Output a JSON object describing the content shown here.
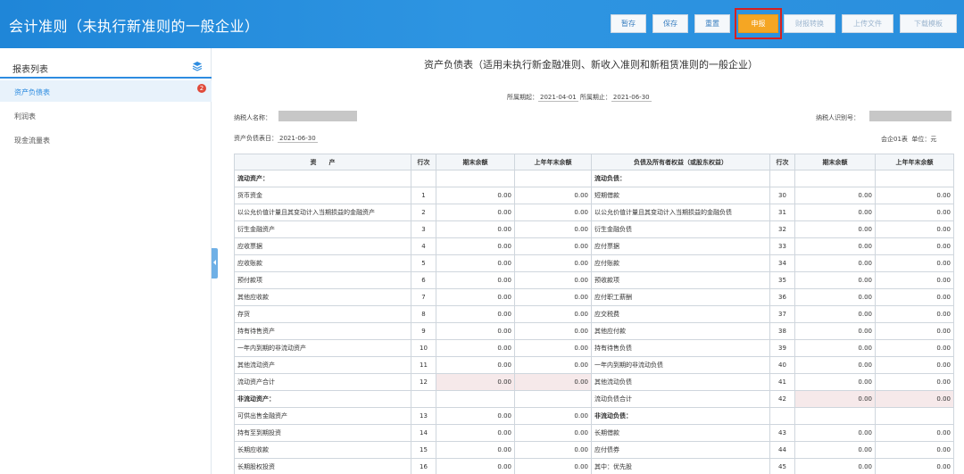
{
  "header": {
    "title": "会计准则（未执行新准则的一般企业）",
    "buttons": [
      {
        "label": "暂存",
        "state": "normal"
      },
      {
        "label": "保存",
        "state": "normal"
      },
      {
        "label": "重置",
        "state": "normal"
      },
      {
        "label": "申报",
        "state": "primary"
      },
      {
        "label": "财报转换",
        "state": "disabled"
      },
      {
        "label": "上传文件",
        "state": "disabled"
      },
      {
        "label": "下载模板",
        "state": "disabled"
      }
    ],
    "primary_color": "#f5a623",
    "highlight_color": "#d62020"
  },
  "sidebar": {
    "title": "报表列表",
    "icon": "layers-icon",
    "items": [
      {
        "label": "资产负债表",
        "badge": "2",
        "active": true
      },
      {
        "label": "利润表"
      },
      {
        "label": "现金流量表"
      }
    ]
  },
  "report": {
    "title": "资产负债表（适用未执行新金融准则、新收入准则和新租赁准则的一般企业）",
    "period_start_label": "所属期起：",
    "period_start": "2021-04-01",
    "period_end_label": "所属期止：",
    "period_end": "2021-06-30",
    "taxpayer_name_label": "纳税人名称：",
    "taxpayer_id_label": "纳税人识别号：",
    "date_label": "资产负债表日：",
    "date": "2021-06-30",
    "form_no": "会企01表",
    "unit": "单位：元"
  },
  "table": {
    "headers": [
      "资　　产",
      "行次",
      "期末余额",
      "上年年末余额",
      "负债及所有者权益（或股东权益）",
      "行次",
      "期末余额",
      "上年年末余额"
    ],
    "rows": [
      {
        "l": "流动资产：",
        "ln": "",
        "le": "",
        "lb": "",
        "r": "流动负债：",
        "rn": "",
        "re": "",
        "rb": "",
        "lt": "cat",
        "rt": "cat"
      },
      {
        "l": "货币资金",
        "ln": "1",
        "le": "0.00",
        "lb": "0.00",
        "r": "短期借款",
        "rn": "30",
        "re": "0.00",
        "rb": "0.00"
      },
      {
        "l": "以公允价值计量且其变动计入当期损益的金融资产",
        "ln": "2",
        "le": "0.00",
        "lb": "0.00",
        "r": "以公允价值计量且其变动计入当期损益的金融负债",
        "rn": "31",
        "re": "0.00",
        "rb": "0.00",
        "lt": "wrap",
        "rt": "wrap"
      },
      {
        "l": "衍生金融资产",
        "ln": "3",
        "le": "0.00",
        "lb": "0.00",
        "r": "衍生金融负债",
        "rn": "32",
        "re": "0.00",
        "rb": "0.00"
      },
      {
        "l": "应收票据",
        "ln": "4",
        "le": "0.00",
        "lb": "0.00",
        "r": "应付票据",
        "rn": "33",
        "re": "0.00",
        "rb": "0.00"
      },
      {
        "l": "应收账款",
        "ln": "5",
        "le": "0.00",
        "lb": "0.00",
        "r": "应付账款",
        "rn": "34",
        "re": "0.00",
        "rb": "0.00"
      },
      {
        "l": "预付款项",
        "ln": "6",
        "le": "0.00",
        "lb": "0.00",
        "r": "预收款项",
        "rn": "35",
        "re": "0.00",
        "rb": "0.00"
      },
      {
        "l": "其他应收款",
        "ln": "7",
        "le": "0.00",
        "lb": "0.00",
        "r": "应付职工薪酬",
        "rn": "36",
        "re": "0.00",
        "rb": "0.00"
      },
      {
        "l": "存货",
        "ln": "8",
        "le": "0.00",
        "lb": "0.00",
        "r": "应交税费",
        "rn": "37",
        "re": "0.00",
        "rb": "0.00"
      },
      {
        "l": "持有待售资产",
        "ln": "9",
        "le": "0.00",
        "lb": "0.00",
        "r": "其他应付款",
        "rn": "38",
        "re": "0.00",
        "rb": "0.00"
      },
      {
        "l": "一年内到期的非流动资产",
        "ln": "10",
        "le": "0.00",
        "lb": "0.00",
        "r": "持有待售负债",
        "rn": "39",
        "re": "0.00",
        "rb": "0.00"
      },
      {
        "l": "其他流动资产",
        "ln": "11",
        "le": "0.00",
        "lb": "0.00",
        "r": "一年内到期的非流动负债",
        "rn": "40",
        "re": "0.00",
        "rb": "0.00"
      },
      {
        "l": "流动资产合计",
        "ln": "12",
        "le": "0.00",
        "lb": "0.00",
        "r": "其他流动负债",
        "rn": "41",
        "re": "0.00",
        "rb": "0.00",
        "lt": "total",
        "ltotal": true
      },
      {
        "l": "非流动资产：",
        "ln": "",
        "le": "",
        "lb": "",
        "r": "流动负债合计",
        "rn": "42",
        "re": "0.00",
        "rb": "0.00",
        "lt": "cat",
        "rt": "total",
        "rtotal": true
      },
      {
        "l": "可供出售金融资产",
        "ln": "13",
        "le": "0.00",
        "lb": "0.00",
        "r": "非流动负债：",
        "rn": "",
        "re": "",
        "rb": "",
        "rt": "cat"
      },
      {
        "l": "持有至到期投资",
        "ln": "14",
        "le": "0.00",
        "lb": "0.00",
        "r": "长期借款",
        "rn": "43",
        "re": "0.00",
        "rb": "0.00"
      },
      {
        "l": "长期应收款",
        "ln": "15",
        "le": "0.00",
        "lb": "0.00",
        "r": "应付债券",
        "rn": "44",
        "re": "0.00",
        "rb": "0.00"
      },
      {
        "l": "长期股权投资",
        "ln": "16",
        "le": "0.00",
        "lb": "0.00",
        "r": "其中：优先股",
        "rn": "45",
        "re": "0.00",
        "rb": "0.00",
        "rt": "sub"
      }
    ]
  }
}
